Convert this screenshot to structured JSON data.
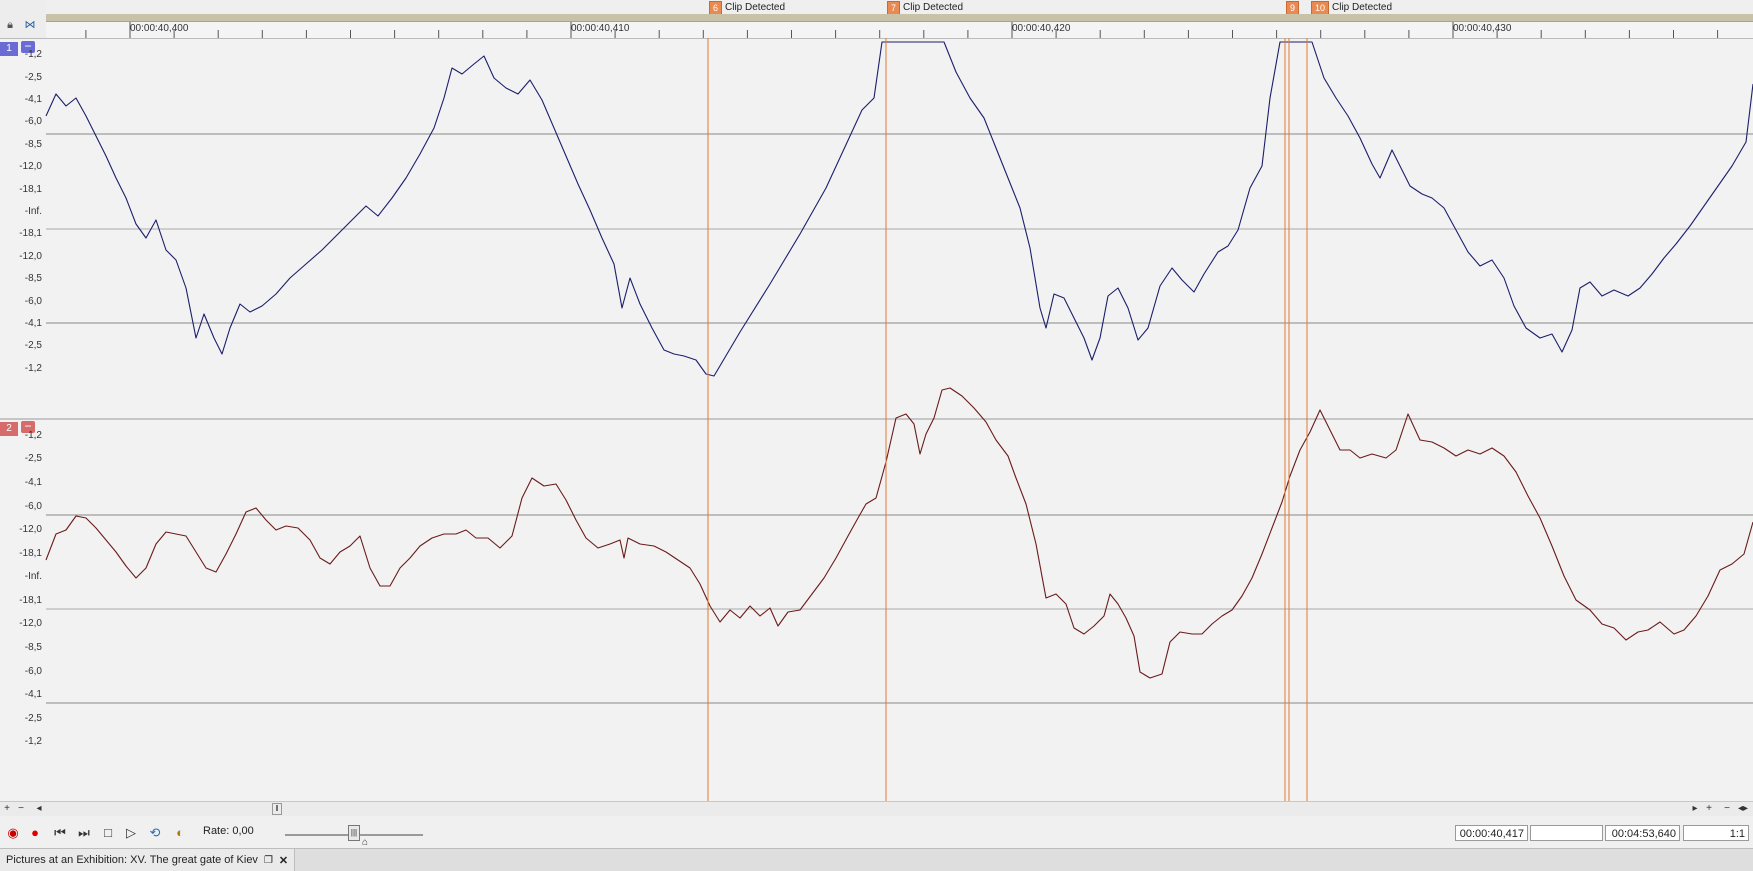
{
  "markers": [
    {
      "num": "6",
      "label": "Clip Detected"
    },
    {
      "num": "7",
      "label": "Clip Detected"
    },
    {
      "num": "9",
      "label": ""
    },
    {
      "num": "10",
      "label": "Clip Detected"
    }
  ],
  "ruler": {
    "labels": [
      "00:00:40,400",
      "00:00:40,410",
      "00:00:40,420",
      "00:00:40,430"
    ]
  },
  "tracks": [
    {
      "num": "1",
      "toggle": "−",
      "color": "#6b6bd6",
      "wave_color": "#1b1f6b",
      "db_labels": [
        "-1,2",
        "-2,5",
        "-4,1",
        "-6,0",
        "-8,5",
        "-12,0",
        "-18,1",
        "-Inf.",
        "-18,1",
        "-12,0",
        "-8,5",
        "-6,0",
        "-4,1",
        "-2,5",
        "-1,2"
      ]
    },
    {
      "num": "2",
      "toggle": "−",
      "color": "#d66b6b",
      "wave_color": "#6b1b1b",
      "db_labels": [
        "-1,2",
        "-2,5",
        "-4,1",
        "-6,0",
        "-12,0",
        "-18,1",
        "-Inf.",
        "-18,1",
        "-12,0",
        "-8,5",
        "-6,0",
        "-4,1",
        "-2,5",
        "-1,2"
      ]
    }
  ],
  "colors": {
    "marker_line": "#e07a30",
    "marker_badge": "#e98a52"
  },
  "transport": {
    "rate_label": "Rate: 0,00",
    "cursor_time": "00:00:40,417",
    "selection_length": "",
    "total_length": "00:04:53,640",
    "zoom": "1:1"
  },
  "icons": [
    "lock-icon",
    "snap-icon",
    "record-arm-icon",
    "record-icon",
    "go-to-start-icon",
    "go-to-end-icon",
    "stop-icon",
    "play-icon",
    "loop-icon",
    "scrub-icon"
  ],
  "document": {
    "tab_title": "Pictures at an Exhibition: XV. The great gate of Kiev",
    "restore_icon": "restore-icon",
    "close_icon": "close-icon"
  }
}
